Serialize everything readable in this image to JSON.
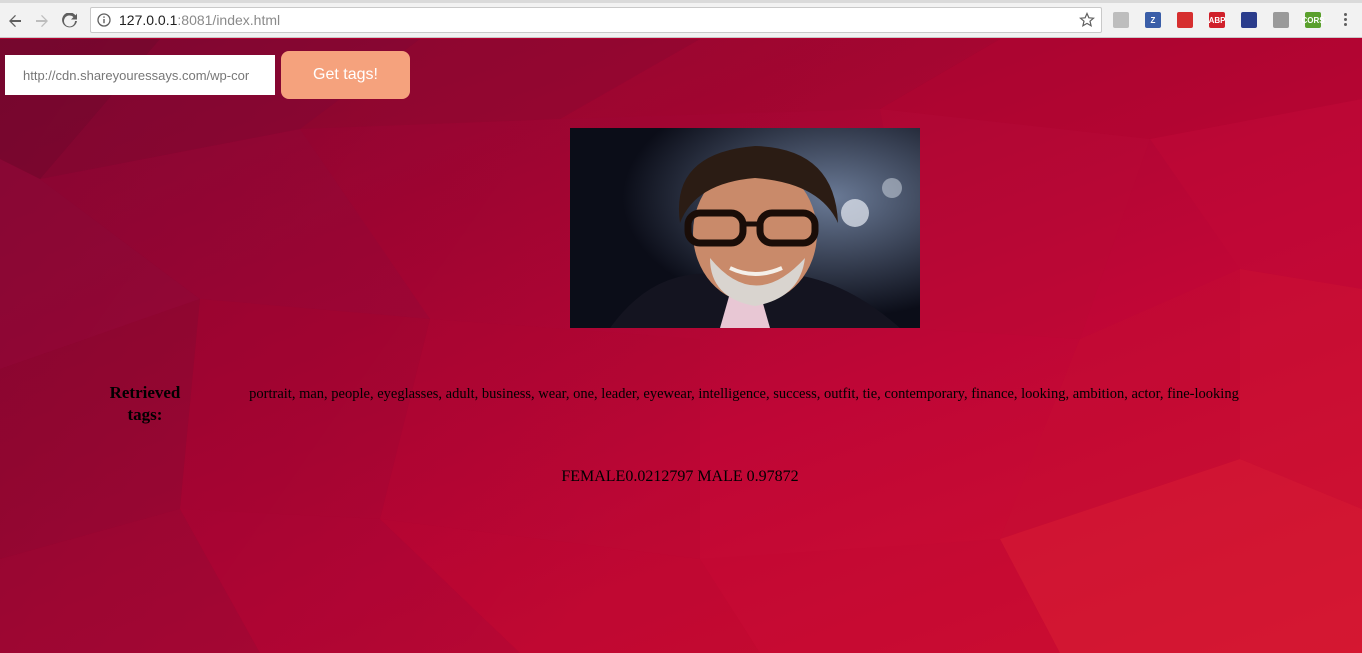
{
  "browser": {
    "url_host": "127.0.0.1",
    "url_port_path": ":8081/index.html",
    "extensions": [
      {
        "name": "pdf-extension-icon",
        "label": "",
        "color": "#bdbdbd"
      },
      {
        "name": "z-extension-icon",
        "label": "Z",
        "color": "#3a5ea8"
      },
      {
        "name": "opera-extension-icon",
        "label": "",
        "color": "#d62f2f"
      },
      {
        "name": "adblock-plus-icon",
        "label": "ABP",
        "color": "#d0202a"
      },
      {
        "name": "flag-extension-icon",
        "label": "",
        "color": "#2b3d8c"
      },
      {
        "name": "gray-extension-icon",
        "label": "",
        "color": "#9a9a9a"
      },
      {
        "name": "cors-extension-icon",
        "label": "CORS",
        "color": "#5aa02c"
      }
    ]
  },
  "form": {
    "url_value": "http://cdn.shareyouressays.com/wp-cor",
    "button_label": "Get tags!",
    "button_color": "#f5a27d"
  },
  "results": {
    "tags_label": "Retrieved tags:",
    "tags": "portrait, man, people, eyeglasses, adult, business, wear, one, leader, eyewear, intelligence, success, outfit, tie, contemporary, finance, looking, ambition, actor, fine-looking",
    "gender": "FEMALE0.0212797 MALE 0.97872"
  },
  "colors": {
    "page_background": "#b5002f",
    "accent": "#f5a27d"
  }
}
